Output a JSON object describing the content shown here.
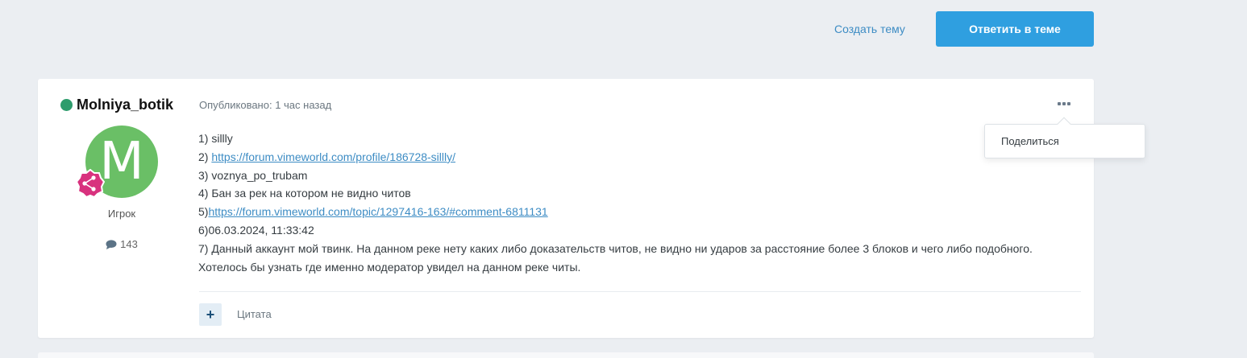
{
  "actions": {
    "create_topic": "Создать тему",
    "reply": "Ответить в теме"
  },
  "post": {
    "author": "Molniya_botik",
    "avatar_letter": "M",
    "rank": "Игрок",
    "post_count": "143",
    "meta": "Опубликовано: 1 час назад",
    "lines": {
      "l1": "1) sillly",
      "l2_prefix": "2) ",
      "l2_link": "https://forum.vimeworld.com/profile/186728-sillly/",
      "l3": "3) voznya_po_trubam",
      "l4": "4) Бан за рек на котором не видно читов",
      "l5_prefix": "5)",
      "l5_link": "https://forum.vimeworld.com/topic/1297416-163/#comment-6811131",
      "l6": "6)06.03.2024, 11:33:42",
      "l7": "7) Данный аккаунт мой твинк. На данном реке нету каких либо доказательств читов, не видно ни ударов за расстояние более 3 блоков и чего либо подобного. Хотелось бы узнать где именно модератор увидел на данном реке читы."
    },
    "quote": "Цитата",
    "plus": "+"
  },
  "share_menu": {
    "item": "Поделиться"
  },
  "colors": {
    "accent": "#2f9fe0",
    "link": "#3d8cc4",
    "online": "#2d9c6c",
    "avatar": "#6abf66",
    "badge": "#d8327e"
  },
  "icons": {
    "menu": "ellipsis-icon",
    "badge": "share-badge-icon",
    "comments": "comment-icon"
  }
}
